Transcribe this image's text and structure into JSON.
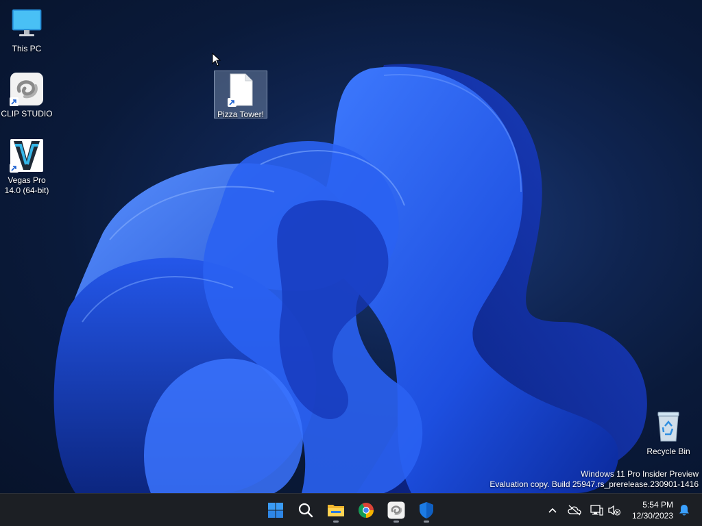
{
  "desktop": {
    "icons": [
      {
        "name": "this-pc",
        "label": "This PC",
        "icon": "monitor-icon"
      },
      {
        "name": "clip-studio",
        "label": "CLIP STUDIO",
        "icon": "clip-studio-icon"
      },
      {
        "name": "vegas-pro",
        "label": "Vegas Pro 14.0 (64-bit)",
        "icon": "vegas-pro-icon"
      },
      {
        "name": "pizza-tower",
        "label": "Pizza Tower!",
        "icon": "file-icon",
        "selected": true
      },
      {
        "name": "recycle-bin",
        "label": "Recycle Bin",
        "icon": "recycle-bin-icon"
      }
    ]
  },
  "watermark": {
    "line1": "Windows 11 Pro Insider Preview",
    "line2": "Evaluation copy. Build 25947.rs_prerelease.230901-1416"
  },
  "taskbar": {
    "apps": [
      {
        "name": "start",
        "icon": "windows-logo-icon"
      },
      {
        "name": "search",
        "icon": "search-icon"
      },
      {
        "name": "file-explorer",
        "icon": "folder-icon",
        "running": true
      },
      {
        "name": "chrome",
        "icon": "chrome-icon"
      },
      {
        "name": "clip-studio",
        "icon": "clip-studio-icon",
        "running": true
      },
      {
        "name": "windows-security",
        "icon": "shield-icon",
        "running": true
      }
    ],
    "tray": [
      "chevron-up-icon",
      "cloud-off-icon",
      "network-icon",
      "volume-muted-icon"
    ],
    "clock": {
      "time": "5:54 PM",
      "date": "12/30/2023"
    },
    "notification_icon": "bell-icon"
  },
  "colors": {
    "taskbar": "#1c1f24",
    "accent_blue": "#2f6bff",
    "wallpaper_dark": "#0a1a3a"
  }
}
